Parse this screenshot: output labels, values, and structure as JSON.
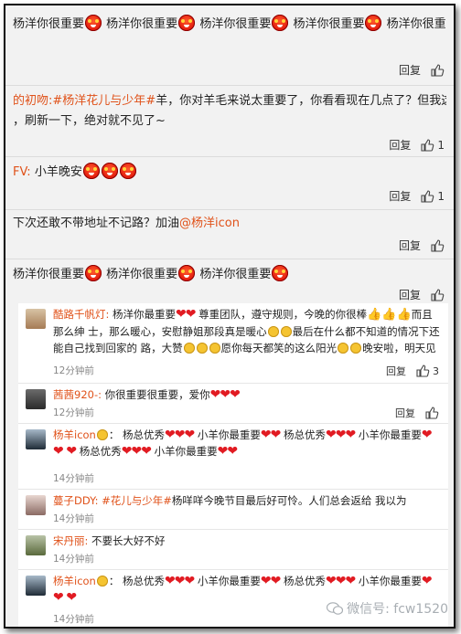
{
  "actions": {
    "reply": "回复",
    "reply_small": "回复"
  },
  "c1": {
    "text": "杨洋你很重要",
    "emoji": "angry-face"
  },
  "c2": {
    "name": "的初吻:",
    "tag": "#杨洋花儿与少年#",
    "text1": "羊，你对羊毛来说太重要了，你看看现在几点了？但我这条评",
    "text2": "，刷新一下，绝对就不见了~",
    "likes": "1"
  },
  "c3": {
    "name": "FV:",
    "text": "小羊晚安",
    "likes": "1"
  },
  "c4": {
    "text": "下次还敢不带地址不记路？加油",
    "mention": "@杨洋icon"
  },
  "c5": {
    "text": "杨洋你很重要"
  },
  "subs": {
    "s1": {
      "name": "酷路千帆灯:",
      "text_a": "杨洋你最重要",
      "text_b": "尊重团队，遵守规则，今晚的你很棒",
      "text_c": "而且那么绅",
      "text_d": "士，那么暖心，安慰静姐那段真是暖心",
      "text_e": "最后在什么都不知道的情况下还能自己找到回家的",
      "text_f": "路，大赞",
      "text_g": "愿你每天都笑的这么阳光",
      "text_h": "晚安啦，明天见",
      "time": "12分钟前",
      "likes": "3"
    },
    "s2": {
      "name": "茜茜920-:",
      "text": "你很重要很重要，爱你",
      "time": "12分钟前"
    },
    "s3": {
      "name": "杨羊icon",
      "t1": "杨总优秀",
      "t2": "小羊你最重要",
      "t3": "杨总优秀",
      "t4": "小羊你最重要",
      "t5": "杨总优秀",
      "t6": "小羊你最重要",
      "time": "14分钟前"
    },
    "s4": {
      "name": "蔓子DDY:",
      "tag": "#花儿与少年#",
      "text": "杨咩咩今晚节目最后好可怜。人们总会返给 我以为",
      "time": "14分钟前"
    },
    "s5": {
      "name": "宋丹丽:",
      "text": "不要长大好不好",
      "time": "14分钟前"
    },
    "s6": {
      "name": "杨羊icon",
      "t1": "杨总优秀",
      "t2": "小羊你最重要",
      "t3": "杨总优秀",
      "t4": "小羊你最重要",
      "time": "14分钟前"
    }
  },
  "watermark": {
    "text": "微信号: fcw1520"
  },
  "colors": {
    "accent": "#e0521a",
    "heart": "#e11b22",
    "bg": "#f2f2f2"
  }
}
